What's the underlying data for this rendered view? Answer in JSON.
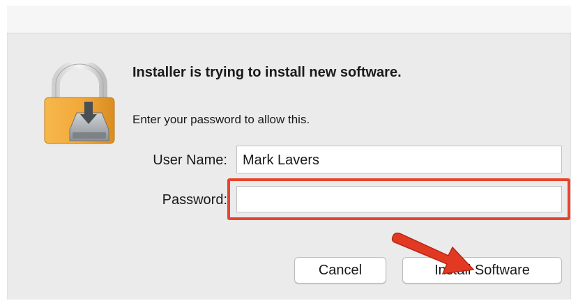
{
  "dialog": {
    "title": "Installer is trying to install new software.",
    "subtitle": "Enter your password to allow this."
  },
  "form": {
    "username_label": "User Name:",
    "username_value": "Mark Lavers",
    "password_label": "Password:",
    "password_value": ""
  },
  "buttons": {
    "cancel_label": "Cancel",
    "install_label": "Install Software"
  },
  "icons": {
    "lock": "lock-install-icon",
    "arrow": "red-arrow-icon"
  },
  "colors": {
    "highlight": "#e8442c",
    "lock_body": "#f0a83a",
    "dialog_bg": "#ebebeb"
  }
}
